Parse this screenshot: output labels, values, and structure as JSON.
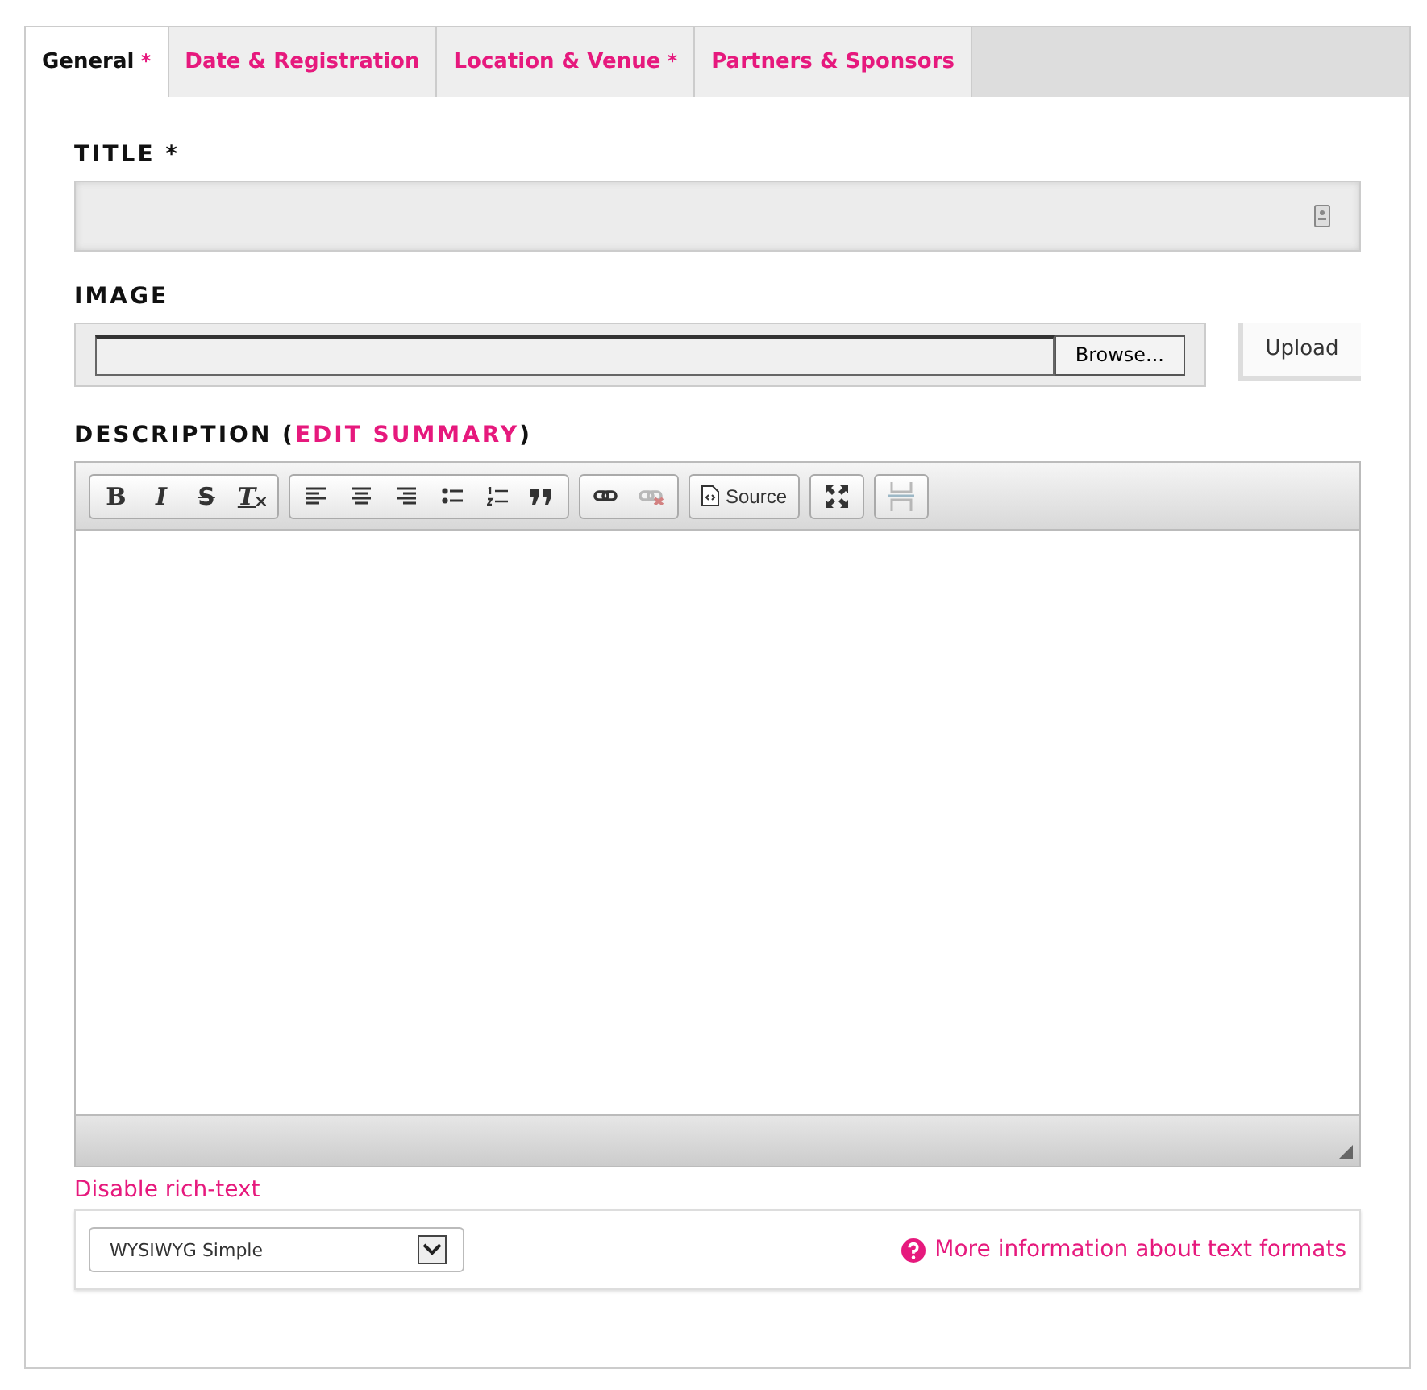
{
  "tabs": [
    {
      "label": "General",
      "required": true,
      "selected": true
    },
    {
      "label": "Date & Registration",
      "required": false,
      "selected": false
    },
    {
      "label": "Location & Venue",
      "required": true,
      "selected": false
    },
    {
      "label": "Partners & Sponsors",
      "required": false,
      "selected": false
    }
  ],
  "required_mark": "*",
  "title_field": {
    "label": "TITLE *"
  },
  "image_field": {
    "label": "IMAGE",
    "browse": "Browse...",
    "upload": "Upload"
  },
  "description": {
    "label": "DESCRIPTION (",
    "link": "EDIT SUMMARY",
    "label_end": ")",
    "toolbar": [
      [
        {
          "kind": "bold",
          "glyph": "B",
          "disabled": false
        },
        {
          "kind": "italic",
          "glyph": "I",
          "disabled": false
        },
        {
          "kind": "strike",
          "glyph": "S",
          "disabled": false
        },
        {
          "kind": "clear",
          "glyph": "T",
          "disabled": false
        }
      ],
      [
        {
          "kind": "left",
          "disabled": false
        },
        {
          "kind": "center",
          "disabled": false
        },
        {
          "kind": "right",
          "disabled": false
        },
        {
          "kind": "bullets",
          "disabled": false
        },
        {
          "kind": "numbers",
          "disabled": false
        },
        {
          "kind": "quote",
          "disabled": false
        }
      ],
      [
        {
          "kind": "link",
          "disabled": false
        },
        {
          "kind": "unlink",
          "disabled": true
        }
      ],
      [
        {
          "kind": "source",
          "glyph": "Source",
          "disabled": false
        }
      ],
      [
        {
          "kind": "maximize",
          "disabled": false
        }
      ],
      [
        {
          "kind": "pagebreak",
          "disabled": true
        }
      ]
    ]
  },
  "disable_rich_text": "Disable rich-text",
  "format": {
    "value": "WYSIWYG Simple",
    "help": "More information about text formats"
  }
}
